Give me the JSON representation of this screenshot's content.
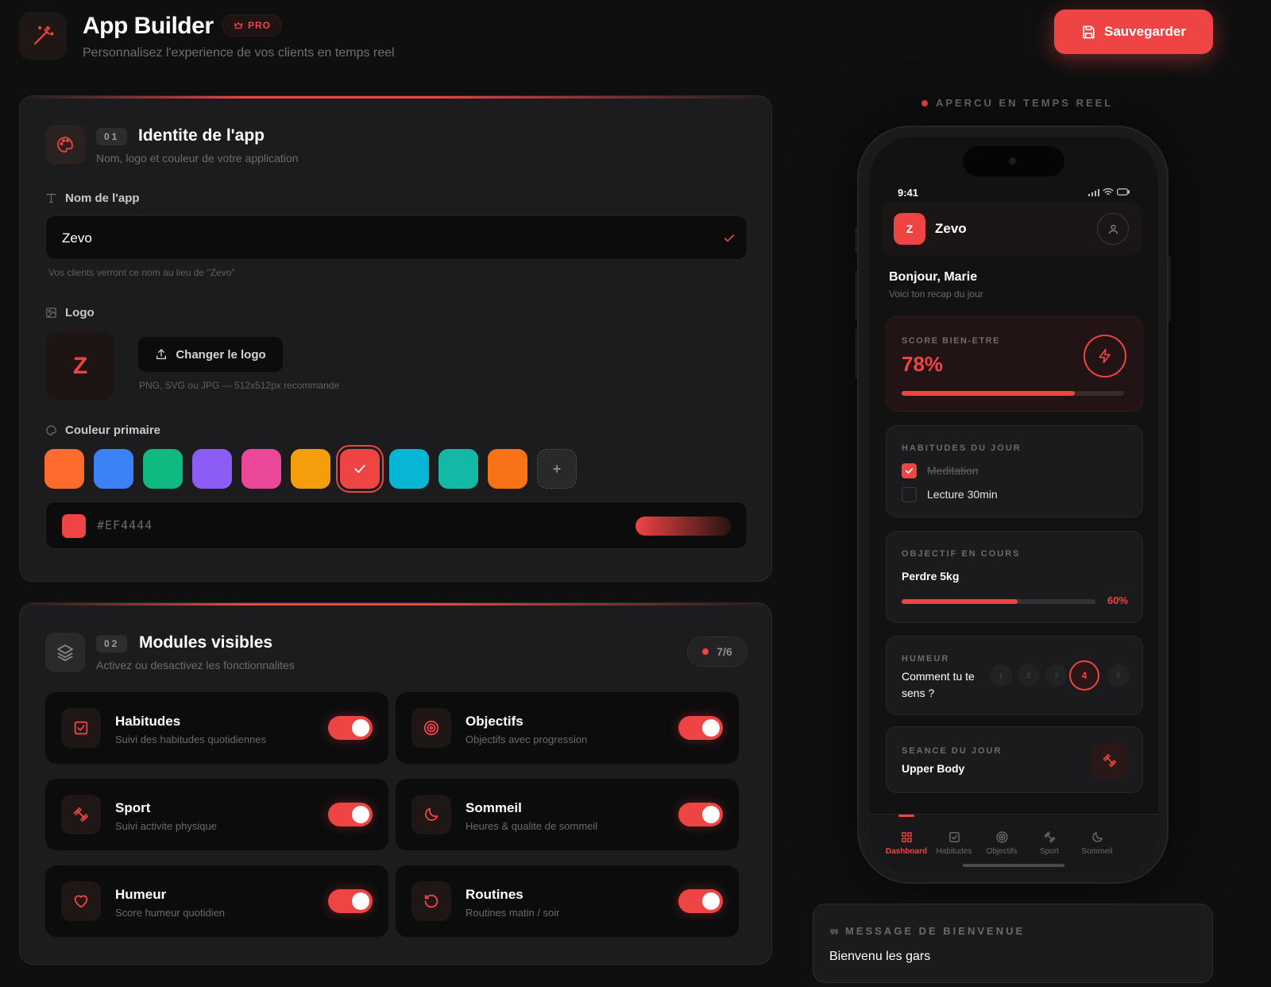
{
  "header": {
    "title": "App Builder",
    "badge": "PRO",
    "subtitle": "Personnalisez l'experience de vos clients en temps reel",
    "save_label": "Sauvegarder"
  },
  "identity": {
    "number": "01",
    "title": "Identite de l'app",
    "subtitle": "Nom, logo et couleur de votre application",
    "name_label": "Nom de l'app",
    "name_value": "Zevo",
    "name_hint": "Vos clients verront ce nom au lieu de \"Zevo\"",
    "logo_label": "Logo",
    "logo_letter": "Z",
    "change_logo": "Changer le logo",
    "logo_hint": "PNG, SVG ou JPG — 512x512px recommande",
    "color_label": "Couleur primaire",
    "swatches": [
      "#ff6b2c",
      "#3b82f6",
      "#10b981",
      "#8b5cf6",
      "#ec4899",
      "#f59e0b",
      "#ef4444",
      "#06b6d4",
      "#14b8a6",
      "#f97316"
    ],
    "selected_swatch": 6,
    "hex_value": "#EF4444",
    "add_color": "+"
  },
  "modules": {
    "number": "02",
    "title": "Modules visibles",
    "subtitle": "Activez ou desactivez les fonctionnalites",
    "count": "7/6",
    "items": [
      {
        "name": "Habitudes",
        "desc": "Suivi des habitudes quotidiennes",
        "icon": "checkbox-icon",
        "enabled": true
      },
      {
        "name": "Objectifs",
        "desc": "Objectifs avec progression",
        "icon": "target-icon",
        "enabled": true
      },
      {
        "name": "Sport",
        "desc": "Suivi activite physique",
        "icon": "dumbbell-icon",
        "enabled": true
      },
      {
        "name": "Sommeil",
        "desc": "Heures & qualite de sommeil",
        "icon": "moon-icon",
        "enabled": true
      },
      {
        "name": "Humeur",
        "desc": "Score humeur quotidien",
        "icon": "heart-icon",
        "enabled": true
      },
      {
        "name": "Routines",
        "desc": "Routines matin / soir",
        "icon": "rotate-icon",
        "enabled": true
      }
    ]
  },
  "preview": {
    "label": "APERCU EN TEMPS REEL",
    "time": "9:41",
    "app_letter": "Z",
    "app_name": "Zevo",
    "greeting": "Bonjour, Marie",
    "greeting_sub": "Voici ton recap du jour",
    "score_label": "SCORE BIEN-ETRE",
    "score_value": "78%",
    "score_fraction": 0.78,
    "habits_label": "HABITUDES DU JOUR",
    "habits": [
      {
        "name": "Meditation",
        "done": true
      },
      {
        "name": "Lecture 30min",
        "done": false
      }
    ],
    "goal_label": "OBJECTIF EN COURS",
    "goal_name": "Perdre 5kg",
    "goal_percent": "60%",
    "goal_fraction": 0.6,
    "mood_label": "HUMEUR",
    "mood_question": "Comment tu te sens ?",
    "mood_scale": [
      "1",
      "2",
      "3",
      "4",
      "5"
    ],
    "mood_selected": 3,
    "session_label": "SEANCE DU JOUR",
    "session_name": "Upper Body",
    "tabs": [
      "Dashboard",
      "Habitudes",
      "Objectifs",
      "Sport",
      "Sommeil"
    ],
    "active_tab": 0
  },
  "welcome": {
    "label": "MESSAGE DE BIENVENUE",
    "text": "Bienvenu les gars"
  },
  "colors": {
    "accent": "#ef4444",
    "background": "#0f0f10",
    "panel": "#1c1c1e"
  }
}
